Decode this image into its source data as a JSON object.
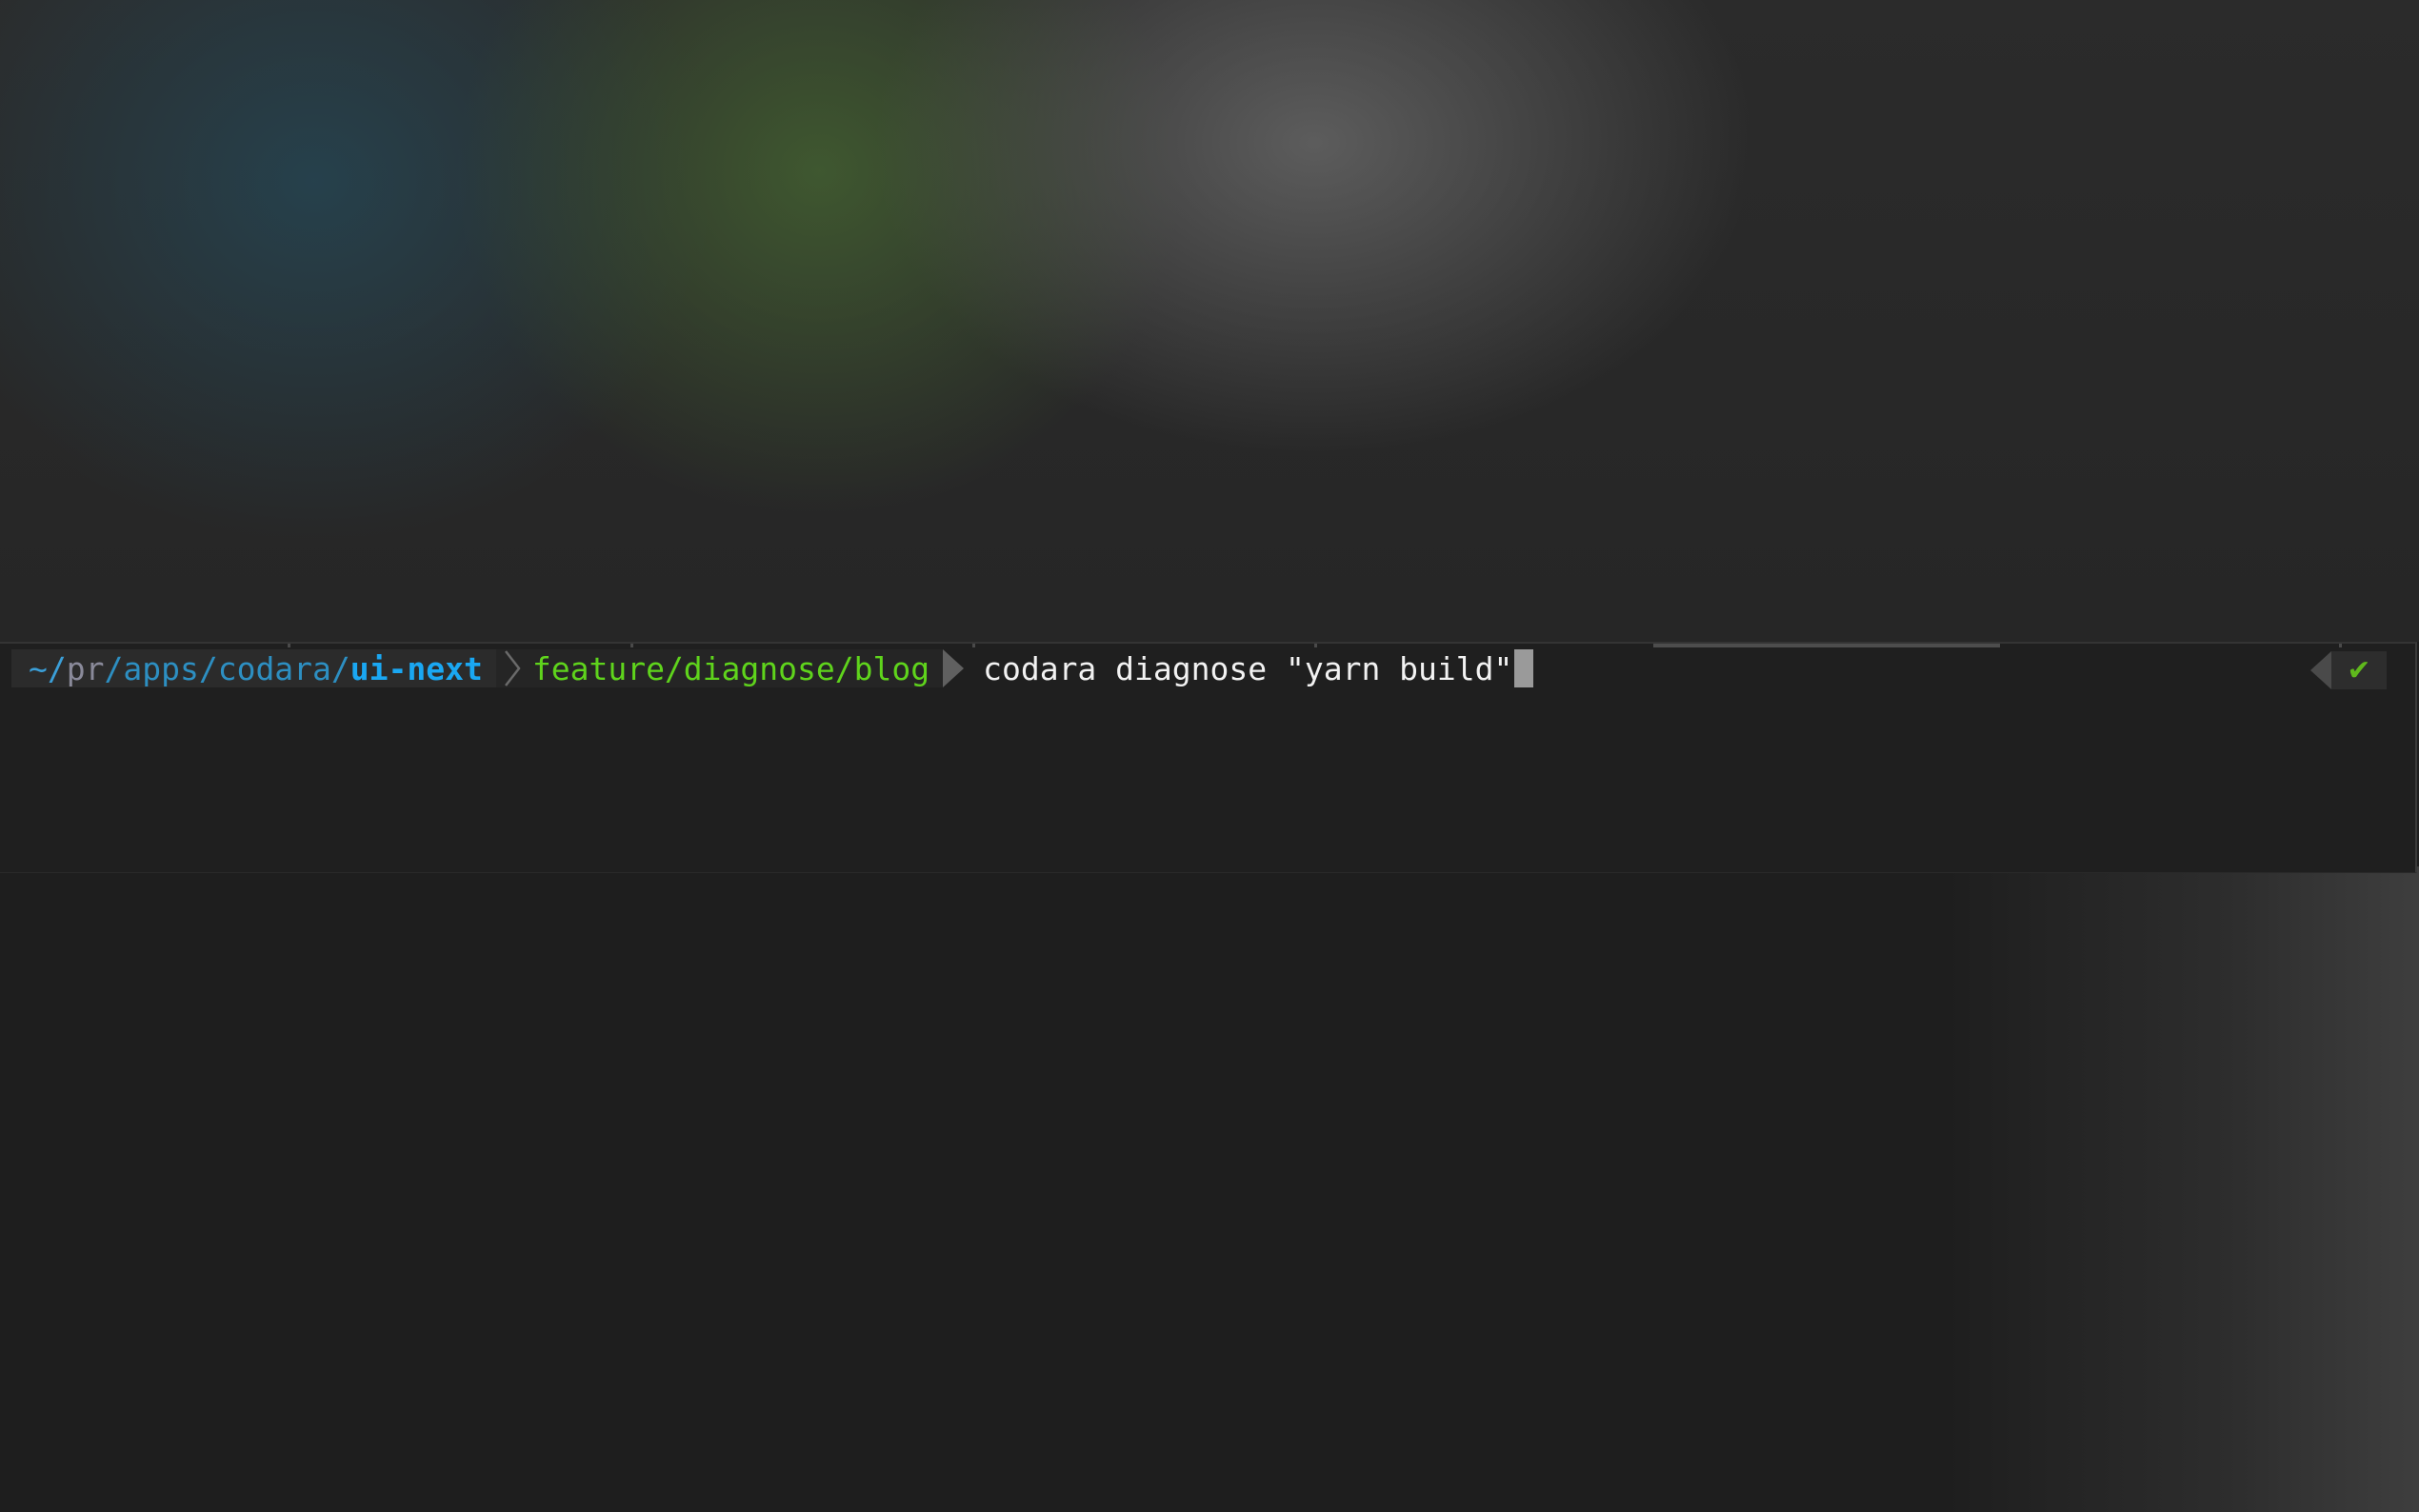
{
  "prompt": {
    "path_tilde": "~/",
    "path_pr": "pr",
    "path_middle": "/apps/codara/",
    "path_current": "ui-next",
    "branch": "feature/diagnose/blog",
    "command": "codara diagnose \"yarn build\""
  },
  "status": {
    "check_glyph": "✔",
    "check_color": "#5fb81c"
  },
  "icons": {
    "thin_separator": "chevron-right-icon",
    "solid_separator": "triangle-right-icon",
    "status_cap": "triangle-left-icon",
    "status_check": "check-icon"
  },
  "colors": {
    "path": "#2d8fc2",
    "path_current": "#1aa7f2",
    "branch": "#5fd41c",
    "command": "#f2f2f2",
    "background": "#1e1e1e"
  }
}
